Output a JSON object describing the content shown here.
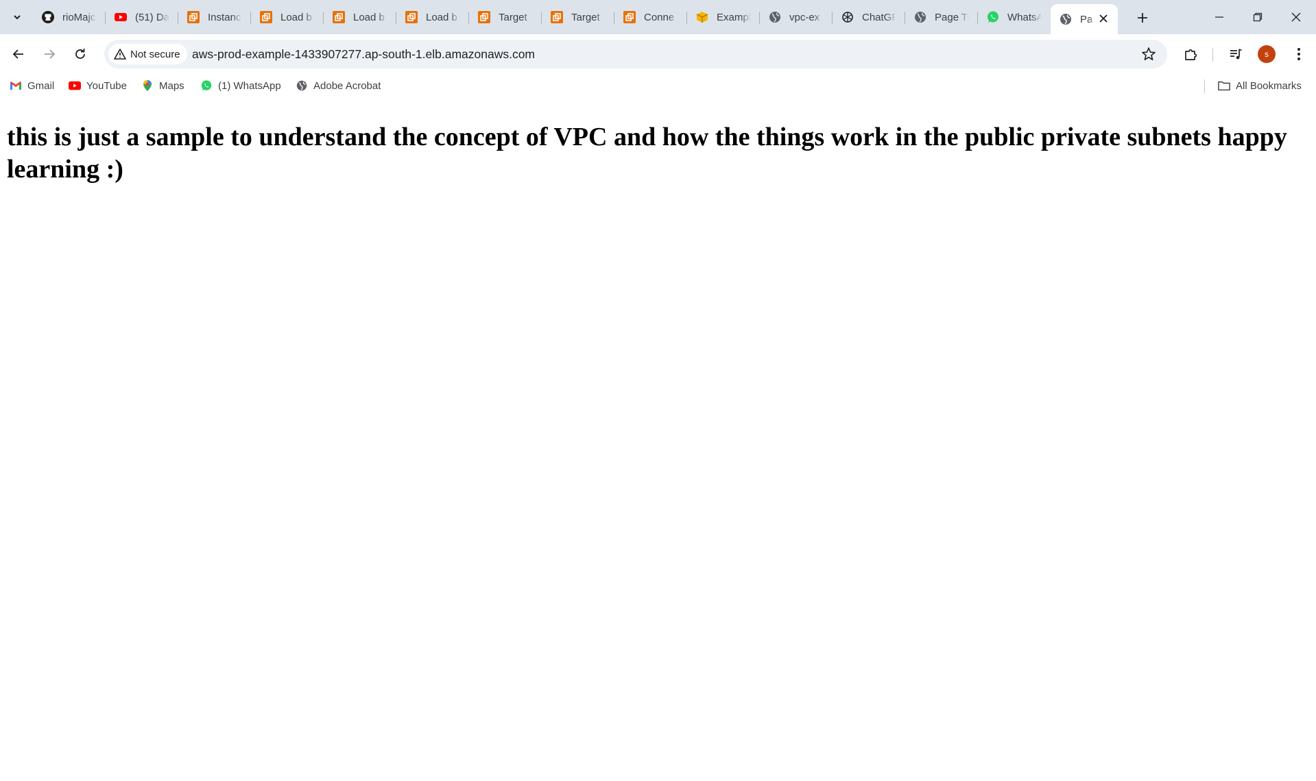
{
  "tabs": [
    {
      "title": "rioMajc",
      "favicon": "github-icon"
    },
    {
      "title": "(51) Da",
      "favicon": "youtube-icon"
    },
    {
      "title": "Instanc",
      "favicon": "aws-console-icon"
    },
    {
      "title": "Load b",
      "favicon": "aws-console-icon"
    },
    {
      "title": "Load b",
      "favicon": "aws-console-icon"
    },
    {
      "title": "Load b",
      "favicon": "aws-console-icon"
    },
    {
      "title": "Target",
      "favicon": "aws-console-icon"
    },
    {
      "title": "Target",
      "favicon": "aws-console-icon"
    },
    {
      "title": "Conne",
      "favicon": "aws-console-icon"
    },
    {
      "title": "Exampl",
      "favicon": "box-icon"
    },
    {
      "title": "vpc-ex",
      "favicon": "globe-icon"
    },
    {
      "title": "ChatGP",
      "favicon": "openai-icon"
    },
    {
      "title": "Page Ti",
      "favicon": "globe-icon"
    },
    {
      "title": "WhatsA",
      "favicon": "whatsapp-icon"
    }
  ],
  "active_tab": {
    "title": "Pa",
    "favicon": "globe-icon"
  },
  "omnibox": {
    "security_label": "Not secure",
    "url": "aws-prod-example-1433907277.ap-south-1.elb.amazonaws.com"
  },
  "profile": {
    "initial": "s",
    "color": "#c2410c"
  },
  "bookmarks": [
    {
      "label": "Gmail",
      "icon": "gmail-icon"
    },
    {
      "label": "YouTube",
      "icon": "youtube-icon"
    },
    {
      "label": "Maps",
      "icon": "maps-icon"
    },
    {
      "label": "(1) WhatsApp",
      "icon": "whatsapp-icon"
    },
    {
      "label": "Adobe Acrobat",
      "icon": "globe-icon"
    }
  ],
  "all_bookmarks_label": "All Bookmarks",
  "page": {
    "heading": "this is just a sample to understand the concept of VPC and how the things work in the public private subnets happy learning :)"
  },
  "colors": {
    "tabstrip_bg": "#dde3ea",
    "omnibox_bg": "#eef1f5",
    "aws_orange": "#e8710a",
    "youtube_red": "#ff0000",
    "whatsapp_green": "#25d366"
  }
}
